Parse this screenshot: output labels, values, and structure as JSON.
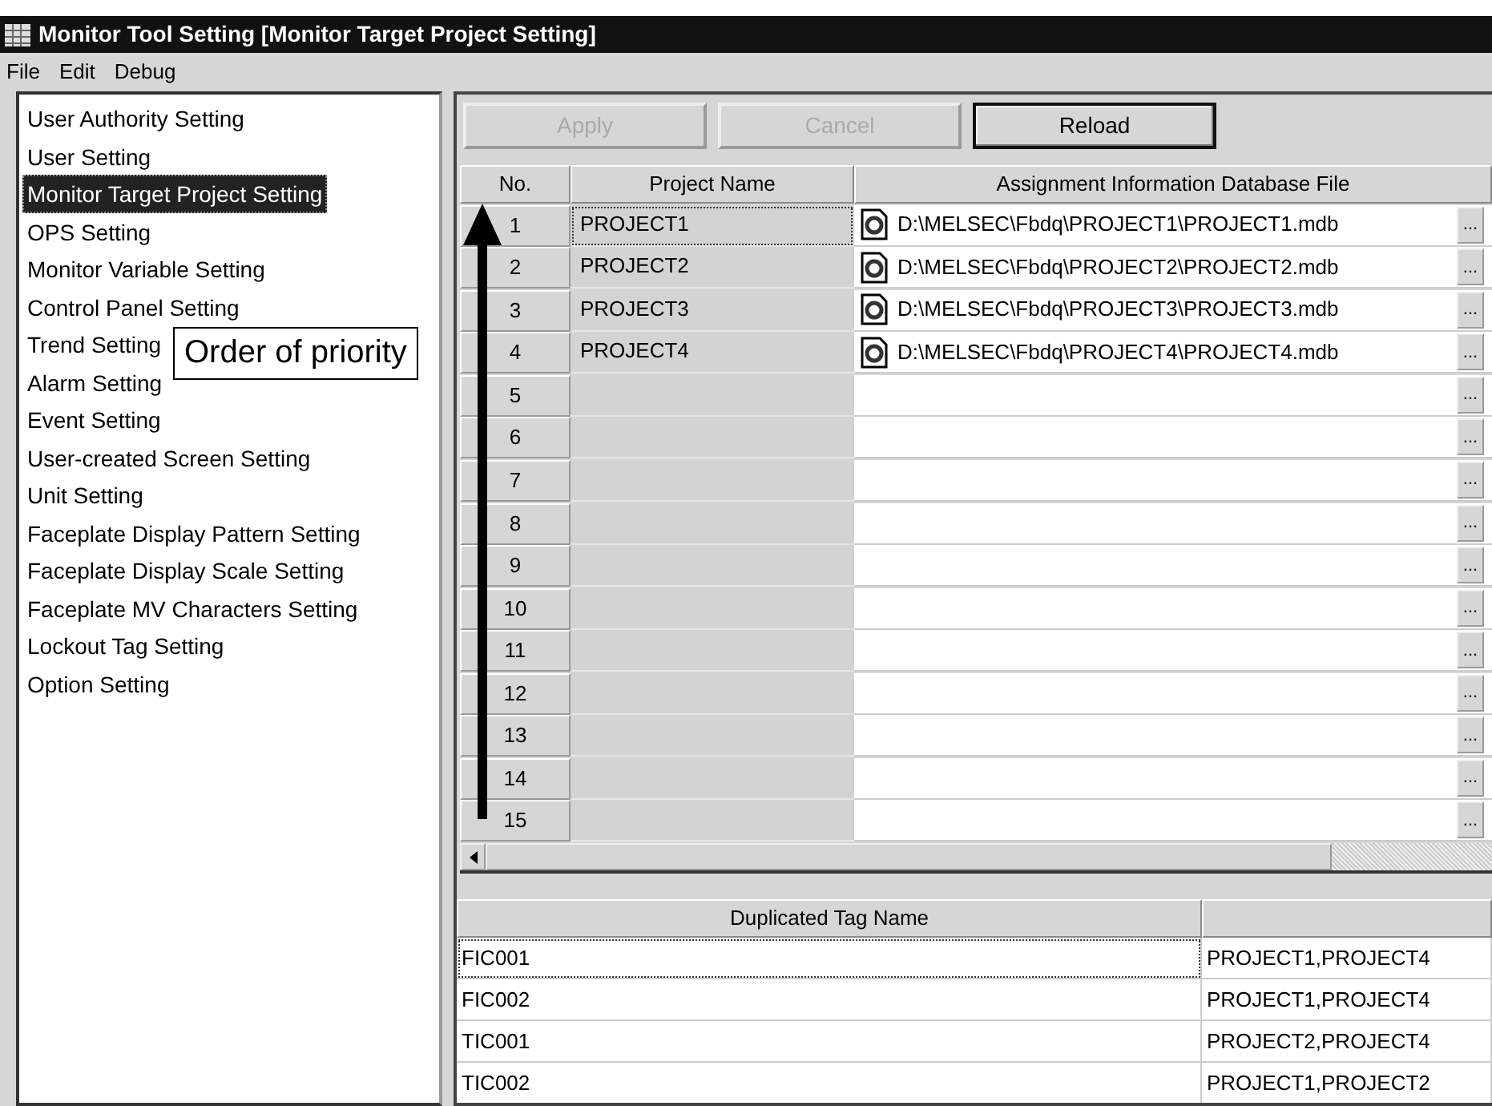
{
  "window": {
    "title": "Monitor Tool Setting [Monitor Target Project Setting]"
  },
  "menu": [
    "File",
    "Edit",
    "Debug"
  ],
  "sidebar": {
    "items": [
      {
        "label": "User Authority Setting",
        "selected": false
      },
      {
        "label": "User Setting",
        "selected": false
      },
      {
        "label": "Monitor Target Project Setting",
        "selected": true
      },
      {
        "label": "OPS Setting",
        "selected": false
      },
      {
        "label": "Monitor Variable Setting",
        "selected": false
      },
      {
        "label": "Control Panel Setting",
        "selected": false
      },
      {
        "label": "Trend Setting",
        "selected": false
      },
      {
        "label": "Alarm Setting",
        "selected": false
      },
      {
        "label": "Event Setting",
        "selected": false
      },
      {
        "label": "User-created Screen Setting",
        "selected": false
      },
      {
        "label": "Unit Setting",
        "selected": false
      },
      {
        "label": "Faceplate Display Pattern Setting",
        "selected": false
      },
      {
        "label": "Faceplate Display Scale Setting",
        "selected": false
      },
      {
        "label": "Faceplate MV Characters Setting",
        "selected": false
      },
      {
        "label": "Lockout Tag Setting",
        "selected": false
      },
      {
        "label": "Option Setting",
        "selected": false
      }
    ]
  },
  "toolbar": [
    {
      "label": "Apply",
      "disabled": true
    },
    {
      "label": "Cancel",
      "disabled": true
    },
    {
      "label": "Reload",
      "disabled": false
    }
  ],
  "project_table": {
    "columns": [
      "No.",
      "Project Name",
      "Assignment Information Database File"
    ],
    "rows": [
      {
        "no": "1",
        "project": "PROJECT1",
        "file": "D:\\MELSEC\\Fbdq\\PROJECT1\\PROJECT1.mdb",
        "browse": "...",
        "focused": true
      },
      {
        "no": "2",
        "project": "PROJECT2",
        "file": "D:\\MELSEC\\Fbdq\\PROJECT2\\PROJECT2.mdb",
        "browse": "...",
        "focused": false
      },
      {
        "no": "3",
        "project": "PROJECT3",
        "file": "D:\\MELSEC\\Fbdq\\PROJECT3\\PROJECT3.mdb",
        "browse": "...",
        "focused": false
      },
      {
        "no": "4",
        "project": "PROJECT4",
        "file": "D:\\MELSEC\\Fbdq\\PROJECT4\\PROJECT4.mdb",
        "browse": "...",
        "focused": false
      },
      {
        "no": "5",
        "browse": "...",
        "focused": false
      },
      {
        "no": "6",
        "browse": "...",
        "focused": false
      },
      {
        "no": "7",
        "browse": "...",
        "focused": false
      },
      {
        "no": "8",
        "browse": "...",
        "focused": false
      },
      {
        "no": "9",
        "browse": "...",
        "focused": false
      },
      {
        "no": "10",
        "browse": "...",
        "focused": false
      },
      {
        "no": "11",
        "browse": "...",
        "focused": false
      },
      {
        "no": "12",
        "browse": "...",
        "focused": false
      },
      {
        "no": "13",
        "browse": "...",
        "focused": false
      },
      {
        "no": "14",
        "browse": "...",
        "focused": false
      },
      {
        "no": "15",
        "browse": "...",
        "focused": false
      }
    ]
  },
  "duplicate_table": {
    "columns": [
      "Duplicated Tag Name"
    ],
    "rows": [
      {
        "tag": "FIC001",
        "projects": "PROJECT1,PROJECT4",
        "focused": true
      },
      {
        "tag": "FIC002",
        "projects": "PROJECT1,PROJECT4",
        "focused": false
      },
      {
        "tag": "TIC001",
        "projects": "PROJECT2,PROJECT4",
        "focused": false
      },
      {
        "tag": "TIC002",
        "projects": "PROJECT1,PROJECT2",
        "focused": false
      }
    ]
  },
  "callout": {
    "text": "Order of priority"
  }
}
